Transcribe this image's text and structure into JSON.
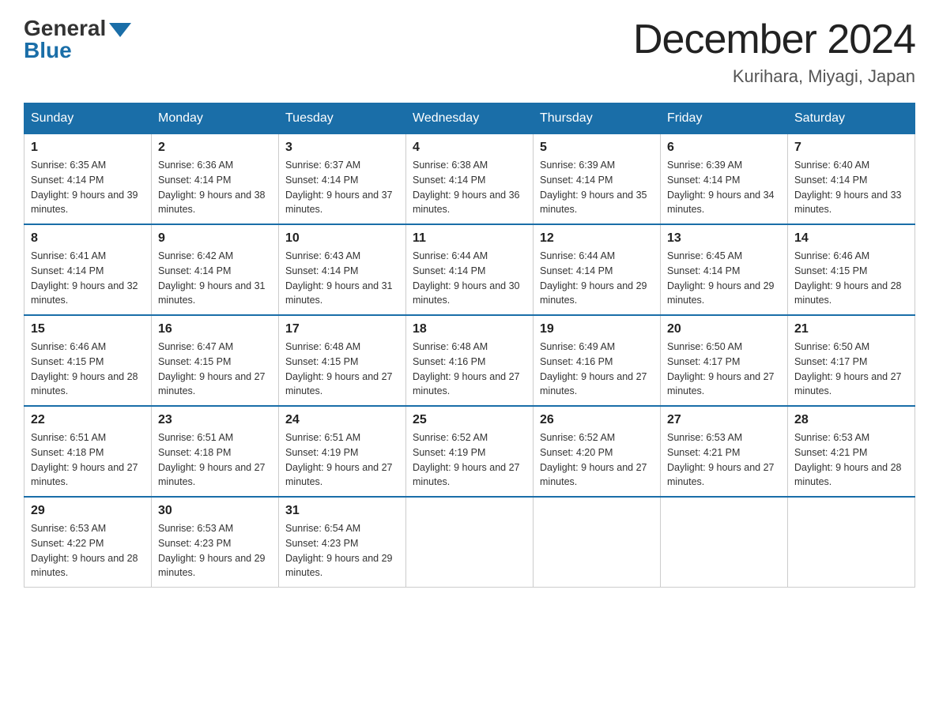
{
  "header": {
    "logo_general": "General",
    "logo_blue": "Blue",
    "title": "December 2024",
    "subtitle": "Kurihara, Miyagi, Japan"
  },
  "days_of_week": [
    "Sunday",
    "Monday",
    "Tuesday",
    "Wednesday",
    "Thursday",
    "Friday",
    "Saturday"
  ],
  "weeks": [
    [
      {
        "day": "1",
        "sunrise": "6:35 AM",
        "sunset": "4:14 PM",
        "daylight": "9 hours and 39 minutes."
      },
      {
        "day": "2",
        "sunrise": "6:36 AM",
        "sunset": "4:14 PM",
        "daylight": "9 hours and 38 minutes."
      },
      {
        "day": "3",
        "sunrise": "6:37 AM",
        "sunset": "4:14 PM",
        "daylight": "9 hours and 37 minutes."
      },
      {
        "day": "4",
        "sunrise": "6:38 AM",
        "sunset": "4:14 PM",
        "daylight": "9 hours and 36 minutes."
      },
      {
        "day": "5",
        "sunrise": "6:39 AM",
        "sunset": "4:14 PM",
        "daylight": "9 hours and 35 minutes."
      },
      {
        "day": "6",
        "sunrise": "6:39 AM",
        "sunset": "4:14 PM",
        "daylight": "9 hours and 34 minutes."
      },
      {
        "day": "7",
        "sunrise": "6:40 AM",
        "sunset": "4:14 PM",
        "daylight": "9 hours and 33 minutes."
      }
    ],
    [
      {
        "day": "8",
        "sunrise": "6:41 AM",
        "sunset": "4:14 PM",
        "daylight": "9 hours and 32 minutes."
      },
      {
        "day": "9",
        "sunrise": "6:42 AM",
        "sunset": "4:14 PM",
        "daylight": "9 hours and 31 minutes."
      },
      {
        "day": "10",
        "sunrise": "6:43 AM",
        "sunset": "4:14 PM",
        "daylight": "9 hours and 31 minutes."
      },
      {
        "day": "11",
        "sunrise": "6:44 AM",
        "sunset": "4:14 PM",
        "daylight": "9 hours and 30 minutes."
      },
      {
        "day": "12",
        "sunrise": "6:44 AM",
        "sunset": "4:14 PM",
        "daylight": "9 hours and 29 minutes."
      },
      {
        "day": "13",
        "sunrise": "6:45 AM",
        "sunset": "4:14 PM",
        "daylight": "9 hours and 29 minutes."
      },
      {
        "day": "14",
        "sunrise": "6:46 AM",
        "sunset": "4:15 PM",
        "daylight": "9 hours and 28 minutes."
      }
    ],
    [
      {
        "day": "15",
        "sunrise": "6:46 AM",
        "sunset": "4:15 PM",
        "daylight": "9 hours and 28 minutes."
      },
      {
        "day": "16",
        "sunrise": "6:47 AM",
        "sunset": "4:15 PM",
        "daylight": "9 hours and 27 minutes."
      },
      {
        "day": "17",
        "sunrise": "6:48 AM",
        "sunset": "4:15 PM",
        "daylight": "9 hours and 27 minutes."
      },
      {
        "day": "18",
        "sunrise": "6:48 AM",
        "sunset": "4:16 PM",
        "daylight": "9 hours and 27 minutes."
      },
      {
        "day": "19",
        "sunrise": "6:49 AM",
        "sunset": "4:16 PM",
        "daylight": "9 hours and 27 minutes."
      },
      {
        "day": "20",
        "sunrise": "6:50 AM",
        "sunset": "4:17 PM",
        "daylight": "9 hours and 27 minutes."
      },
      {
        "day": "21",
        "sunrise": "6:50 AM",
        "sunset": "4:17 PM",
        "daylight": "9 hours and 27 minutes."
      }
    ],
    [
      {
        "day": "22",
        "sunrise": "6:51 AM",
        "sunset": "4:18 PM",
        "daylight": "9 hours and 27 minutes."
      },
      {
        "day": "23",
        "sunrise": "6:51 AM",
        "sunset": "4:18 PM",
        "daylight": "9 hours and 27 minutes."
      },
      {
        "day": "24",
        "sunrise": "6:51 AM",
        "sunset": "4:19 PM",
        "daylight": "9 hours and 27 minutes."
      },
      {
        "day": "25",
        "sunrise": "6:52 AM",
        "sunset": "4:19 PM",
        "daylight": "9 hours and 27 minutes."
      },
      {
        "day": "26",
        "sunrise": "6:52 AM",
        "sunset": "4:20 PM",
        "daylight": "9 hours and 27 minutes."
      },
      {
        "day": "27",
        "sunrise": "6:53 AM",
        "sunset": "4:21 PM",
        "daylight": "9 hours and 27 minutes."
      },
      {
        "day": "28",
        "sunrise": "6:53 AM",
        "sunset": "4:21 PM",
        "daylight": "9 hours and 28 minutes."
      }
    ],
    [
      {
        "day": "29",
        "sunrise": "6:53 AM",
        "sunset": "4:22 PM",
        "daylight": "9 hours and 28 minutes."
      },
      {
        "day": "30",
        "sunrise": "6:53 AM",
        "sunset": "4:23 PM",
        "daylight": "9 hours and 29 minutes."
      },
      {
        "day": "31",
        "sunrise": "6:54 AM",
        "sunset": "4:23 PM",
        "daylight": "9 hours and 29 minutes."
      },
      null,
      null,
      null,
      null
    ]
  ]
}
